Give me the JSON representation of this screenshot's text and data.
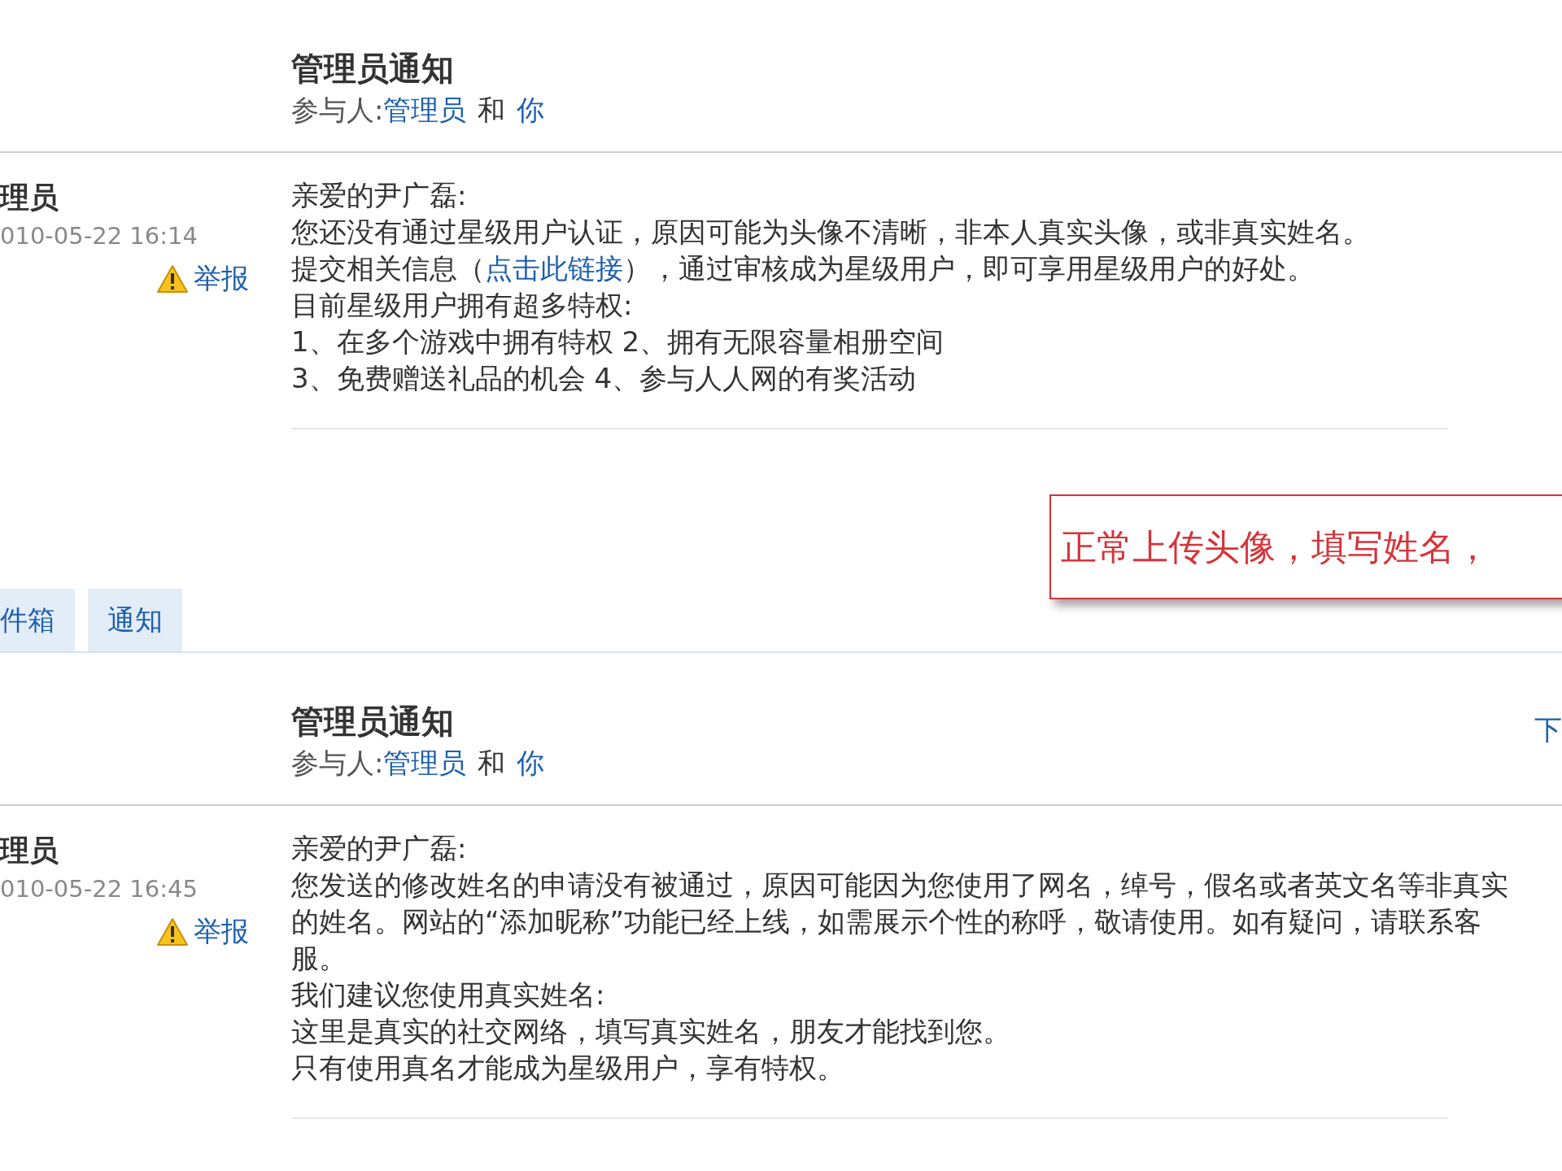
{
  "blocks": [
    {
      "kind": "message",
      "title": "管理员通知",
      "participants_label": "参与人:",
      "participants": [
        {
          "text": "管理员",
          "kind": "link"
        },
        {
          "text": "和",
          "kind": "plain"
        },
        {
          "text": "你",
          "kind": "link"
        }
      ],
      "sender": "理员",
      "time": "010-05-22 16:14",
      "report": "举报",
      "body": [
        [
          {
            "text": "亲爱的尹广磊:",
            "kind": "plain"
          }
        ],
        [
          {
            "text": "您还没有通过星级用户认证，原因可能为头像不清晰，非本人真实头像，或非真实姓名。",
            "kind": "plain"
          }
        ],
        [
          {
            "text": "提交相关信息（",
            "kind": "plain"
          },
          {
            "text": "点击此链接",
            "kind": "link"
          },
          {
            "text": "），通过审核成为星级用户，即可享用星级用户的好处。",
            "kind": "plain"
          }
        ],
        [
          {
            "text": "目前星级用户拥有超多特权:",
            "kind": "plain"
          }
        ],
        [
          {
            "text": "1、在多个游戏中拥有特权 2、拥有无限容量相册空间",
            "kind": "plain"
          }
        ],
        [
          {
            "text": "3、免费赠送礼品的机会 4、参与人人网的有奖活动",
            "kind": "plain"
          }
        ]
      ]
    },
    {
      "kind": "nav",
      "tabs": [
        {
          "label": "件箱",
          "selected": false
        },
        {
          "label": "通知",
          "selected": false
        }
      ],
      "notice": "正常上传头像，填写姓名，"
    },
    {
      "kind": "message",
      "title": "管理员通知",
      "next_link": "下",
      "participants_label": "参与人:",
      "participants": [
        {
          "text": "管理员",
          "kind": "link"
        },
        {
          "text": "和",
          "kind": "plain"
        },
        {
          "text": "你",
          "kind": "link"
        }
      ],
      "sender": "理员",
      "time": "010-05-22 16:45",
      "report": "举报",
      "body": [
        [
          {
            "text": "亲爱的尹广磊:",
            "kind": "plain"
          }
        ],
        [
          {
            "text": "您发送的修改姓名的申请没有被通过，原因可能因为您使用了网名，绰号，假名或者英文名等非真实的姓名。网站的“添加昵称”功能已经上线，如需展示个性的称呼，敬请使用。如有疑问，请联系客服。",
            "kind": "plain"
          }
        ],
        [
          {
            "text": "我们建议您使用真实姓名:",
            "kind": "plain"
          }
        ],
        [
          {
            "text": "这里是真实的社交网络，填写真实姓名，朋友才能找到您。",
            "kind": "plain"
          }
        ],
        [
          {
            "text": "只有使用真名才能成为星级用户，享有特权。",
            "kind": "plain"
          }
        ]
      ]
    }
  ]
}
